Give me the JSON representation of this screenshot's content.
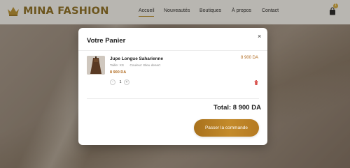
{
  "brand": {
    "name": "MINA FASHION",
    "color": "#8a6a1e"
  },
  "nav": {
    "items": [
      {
        "label": "Accueil",
        "active": true
      },
      {
        "label": "Nouveautés",
        "active": false
      },
      {
        "label": "Boutiques",
        "active": false
      },
      {
        "label": "À propos",
        "active": false
      },
      {
        "label": "Contact",
        "active": false
      }
    ]
  },
  "cart": {
    "badge_count": "1"
  },
  "modal": {
    "title": "Votre Panier",
    "close_label": "×",
    "item": {
      "name": "Jupe Longue Saharienne",
      "size_label": "Taille: XS",
      "color_label": "Couleur: Bleu desert",
      "unit_price": "8 900 DA",
      "line_price": "8 900 DA",
      "quantity": "1",
      "minus_label": "-",
      "plus_label": "+"
    },
    "total_label": "Total: 8 900 DA",
    "checkout_label": "Passer la commande",
    "accent_color": "#b06a1e"
  }
}
